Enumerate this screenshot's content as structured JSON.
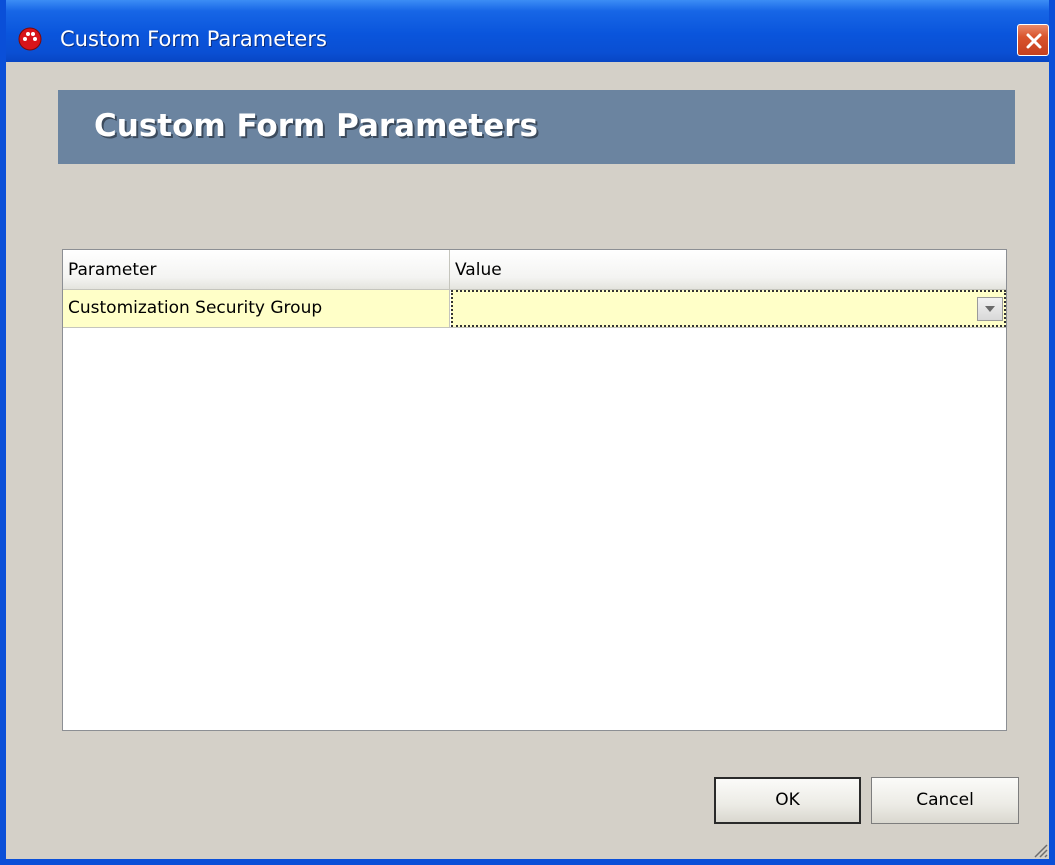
{
  "window": {
    "title": "Custom Form Parameters",
    "icon": "app-logo-icon",
    "close_icon": "close-icon"
  },
  "banner": {
    "title": "Custom Form Parameters"
  },
  "grid": {
    "columns": [
      "Parameter",
      "Value"
    ],
    "rows": [
      {
        "parameter": "Customization Security Group",
        "value": ""
      }
    ],
    "dropdown_icon": "chevron-down-icon"
  },
  "buttons": {
    "ok_label": "OK",
    "cancel_label": "Cancel"
  },
  "colors": {
    "title_bar": "#0a55dc",
    "banner": "#6b84a0",
    "row_highlight": "#ffffc8",
    "dialog_background": "#d4d0c8"
  }
}
